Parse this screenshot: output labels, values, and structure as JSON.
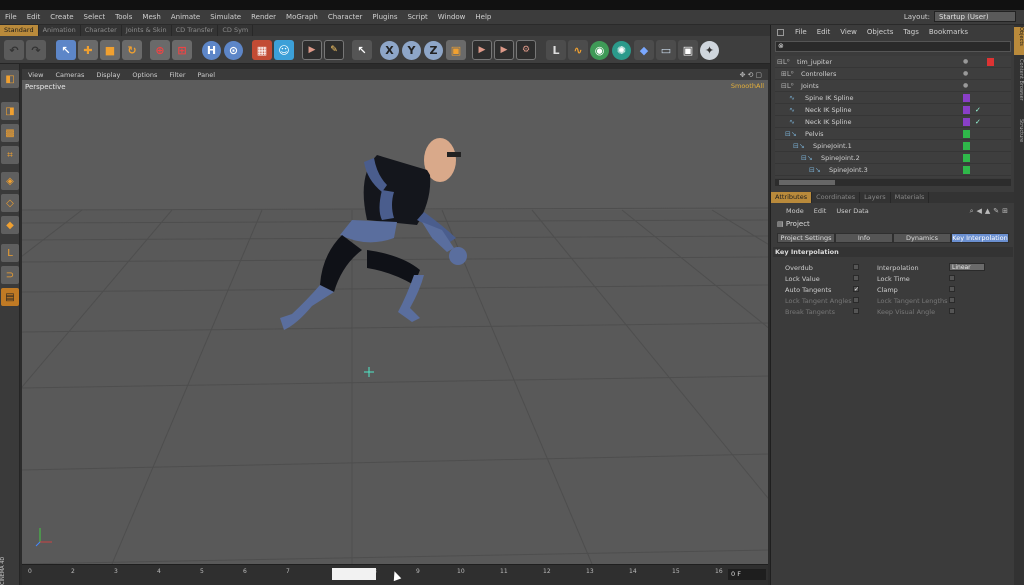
{
  "menu": [
    "File",
    "Edit",
    "Create",
    "Select",
    "Tools",
    "Mesh",
    "Animate",
    "Simulate",
    "Render",
    "MoGraph",
    "Character",
    "Plugins",
    "Script",
    "Window",
    "Help"
  ],
  "layout": {
    "label": "Layout:",
    "value": "Startup (User)"
  },
  "subtabs": [
    "Standard",
    "Animation",
    "Character",
    "Joints & Skin",
    "CD Transfer",
    "CD Sym"
  ],
  "viewport": {
    "menu": [
      "View",
      "Cameras",
      "Display",
      "Options",
      "Filter",
      "Panel"
    ],
    "camera_label": "Perspective",
    "shading_badge": "SmoothAll"
  },
  "timeline": {
    "ticks": [
      "0",
      "2",
      "3",
      "4",
      "5",
      "6",
      "7",
      "8",
      "9",
      "10",
      "11",
      "12",
      "13",
      "14",
      "15",
      "16",
      "17"
    ],
    "frame_value": "0 F"
  },
  "brand_vertical": "CINEMA 4D",
  "objects": {
    "menu": [
      "File",
      "Edit",
      "View",
      "Objects",
      "Tags",
      "Bookmarks"
    ],
    "rows": [
      {
        "name": "tim_jupiter",
        "indent": 0
      },
      {
        "name": "Controllers",
        "indent": 1
      },
      {
        "name": "Joints",
        "indent": 1
      },
      {
        "name": "Spine IK Spline",
        "indent": 2
      },
      {
        "name": "Neck IK Spline",
        "indent": 2
      },
      {
        "name": "Neck IK Spline",
        "indent": 2
      },
      {
        "name": "Pelvis",
        "indent": 2
      },
      {
        "name": "SpineJoint.1",
        "indent": 3
      },
      {
        "name": "SpineJoint.2",
        "indent": 4
      },
      {
        "name": "SpineJoint.3",
        "indent": 5
      }
    ]
  },
  "attributes": {
    "tabs": [
      "Attributes",
      "Coordinates",
      "Layers",
      "Materials"
    ],
    "menu": [
      "Mode",
      "Edit",
      "User Data"
    ],
    "title": "Project",
    "panel_tabs": [
      "Project Settings",
      "Info",
      "Dynamics",
      "Key Interpolation"
    ],
    "section": "Key Interpolation",
    "left_props": [
      {
        "label": "Overdub",
        "checked": false,
        "dim": false
      },
      {
        "label": "Lock Value",
        "checked": false,
        "dim": false
      },
      {
        "label": "Auto Tangents",
        "checked": true,
        "dim": false
      },
      {
        "label": "Lock Tangent Angles",
        "checked": false,
        "dim": true
      },
      {
        "label": "Break Tangents",
        "checked": false,
        "dim": true
      }
    ],
    "right_props": [
      {
        "label": "Interpolation",
        "value": "Linear",
        "dim": false
      },
      {
        "label": "Lock Time",
        "checked": false,
        "dim": false
      },
      {
        "label": "Clamp",
        "checked": false,
        "dim": false
      },
      {
        "label": "Lock Tangent Lengths",
        "checked": false,
        "dim": true
      },
      {
        "label": "Keep Visual Angle",
        "checked": false,
        "dim": true
      }
    ]
  },
  "side_tabs": [
    "Objects",
    "Content Browser",
    "Structure"
  ],
  "colors": {
    "accent": "#b98a3b",
    "viewport": "#595959",
    "selected_tab": "#6a8fd0"
  }
}
